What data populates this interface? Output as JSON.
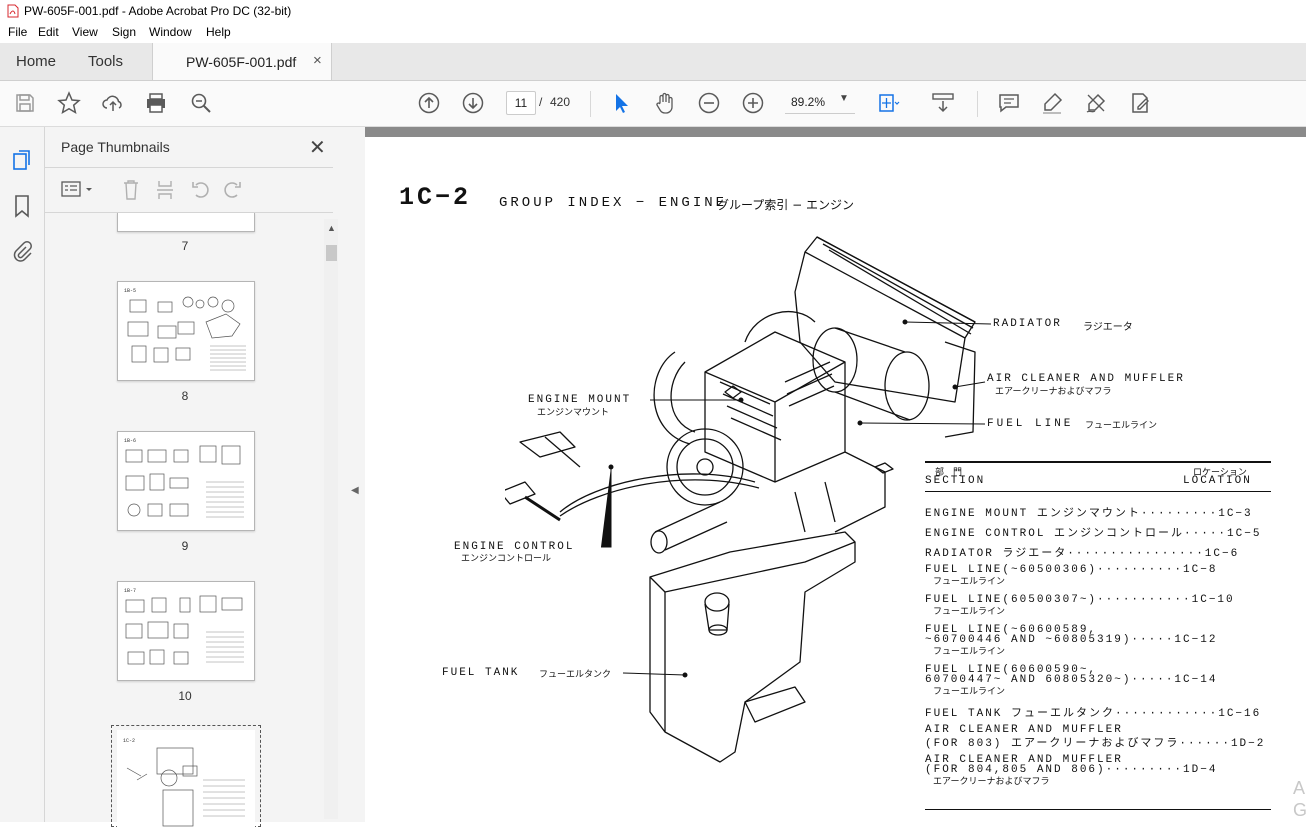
{
  "window": {
    "title": "PW-605F-001.pdf - Adobe Acrobat Pro DC (32-bit)"
  },
  "menu": [
    "File",
    "Edit",
    "View",
    "Sign",
    "Window",
    "Help"
  ],
  "tabs": {
    "home": "Home",
    "tools": "Tools",
    "document": "PW-605F-001.pdf",
    "close_glyph": "×"
  },
  "toolbar": {
    "current_page": "11",
    "page_separator": "/",
    "total_pages": "420",
    "zoom": "89.2%"
  },
  "thumbnails": {
    "title": "Page Thumbnails",
    "close_glyph": "✕",
    "pages": [
      "7",
      "8",
      "9",
      "10"
    ],
    "selected_page_number": 11
  },
  "document": {
    "heading_code": "1C−2",
    "heading_title": "GROUP INDEX − ENGINE",
    "heading_jp": "グループ索引 − エンジン",
    "callouts": {
      "radiator": "RADIATOR",
      "radiator_jp": "ラジエータ",
      "air_cleaner": "AIR CLEANER AND MUFFLER",
      "air_cleaner_jp": "エアークリーナおよびマフラ",
      "fuel_line": "FUEL LINE",
      "fuel_line_jp": "フューエルライン",
      "engine_mount": "ENGINE MOUNT",
      "engine_mount_jp": "エンジンマウント",
      "engine_control": "ENGINE CONTROL",
      "engine_control_jp": "エンジンコントロール",
      "fuel_tank": "FUEL TANK",
      "fuel_tank_jp": "フューエルタンク"
    },
    "index_header": {
      "section_jp": "部　門",
      "section": "SECTION",
      "location_jp": "ロケーション",
      "location": "LOCATION"
    },
    "index_rows": [
      {
        "line1": "ENGINE MOUNT エンジンマウント·········1C−3",
        "sub": ""
      },
      {
        "line1": "ENGINE CONTROL エンジンコントロール·····1C−5",
        "sub": ""
      },
      {
        "line1": "RADIATOR ラジエータ················1C−6",
        "sub": ""
      },
      {
        "line1": "FUEL LINE(~60500306)··········1C−8",
        "sub": "フューエルライン"
      },
      {
        "line1": "FUEL LINE(60500307~)···········1C−10",
        "sub": "フューエルライン"
      },
      {
        "line1": "FUEL LINE(~60600589,",
        "line2": " ~60700446 AND ~60805319)·····1C−12",
        "sub": "フューエルライン"
      },
      {
        "line1": "FUEL LINE(60600590~,",
        "line2": " 60700447~ AND 60805320~)·····1C−14",
        "sub": "フューエルライン"
      },
      {
        "line1": "FUEL TANK フューエルタンク············1C−16",
        "sub": ""
      },
      {
        "line1": "AIR CLEANER AND MUFFLER",
        "line2": " (FOR 803) エアークリーナおよびマフラ······1D−2",
        "sub": ""
      },
      {
        "line1": "AIR CLEANER AND MUFFLER",
        "line2": " (FOR 804,805 AND 806)·········1D−4",
        "sub": "エアークリーナおよびマフラ"
      }
    ],
    "watermark": "A\nG"
  },
  "colors": {
    "acrobat_red": "#d7282f",
    "toolbar_icon": "#5a5a5a",
    "select_blue": "#1473e6"
  },
  "icons": [
    "save-icon",
    "star-icon",
    "upload-icon",
    "print-icon",
    "zoom-search-icon",
    "page-up-icon",
    "page-down-icon",
    "select-cursor-icon",
    "hand-icon",
    "zoom-out-icon",
    "zoom-in-icon",
    "fit-page-icon",
    "scroll-mode-icon",
    "comment-icon",
    "highlight-icon",
    "sign-icon",
    "edit-pdf-icon"
  ]
}
